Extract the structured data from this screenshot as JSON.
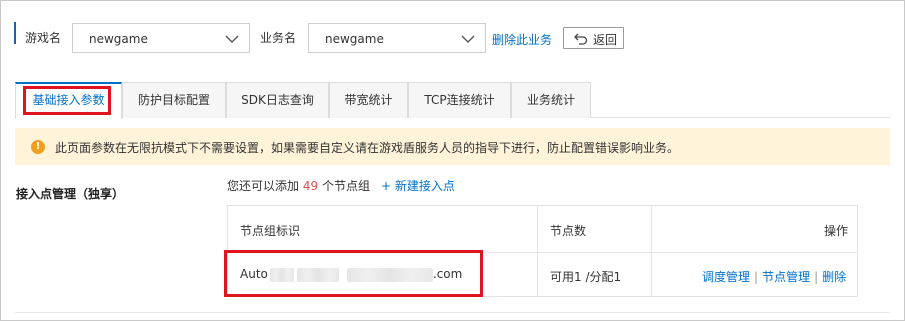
{
  "filter": {
    "game_label": "游戏名",
    "game_value": "newgame",
    "business_label": "业务名",
    "business_value": "newgame",
    "delete_business": "删除此业务",
    "back_label": "返回"
  },
  "tabs": [
    {
      "label": "基础接入参数",
      "active": true
    },
    {
      "label": "防护目标配置",
      "active": false
    },
    {
      "label": "SDK日志查询",
      "active": false
    },
    {
      "label": "带宽统计",
      "active": false
    },
    {
      "label": "TCP连接统计",
      "active": false
    },
    {
      "label": "业务统计",
      "active": false
    }
  ],
  "notice": {
    "icon": "warning-icon",
    "text": "此页面参数在无限抗模式下不需要设置，如果需要自定义请在游戏盾服务人员的指导下进行，防止配置错误影响业务。"
  },
  "access_points": {
    "section_title": "接入点管理（独享）",
    "hint_prefix": "您还可以添加",
    "remaining": "49",
    "hint_suffix": "个节点组",
    "add_label": "+ 新建接入点",
    "columns": [
      "节点组标识",
      "节点数",
      "操作"
    ],
    "rows": [
      {
        "id_prefix": "Auto",
        "id_suffix": ".com",
        "nodes": "可用1 /分配1",
        "actions": [
          "调度管理",
          "节点管理",
          "删除"
        ]
      }
    ]
  },
  "colors": {
    "accent": "#0070cc",
    "highlight": "#e0141e",
    "notice_bg": "#fff3d9",
    "warn": "#f0a020"
  }
}
